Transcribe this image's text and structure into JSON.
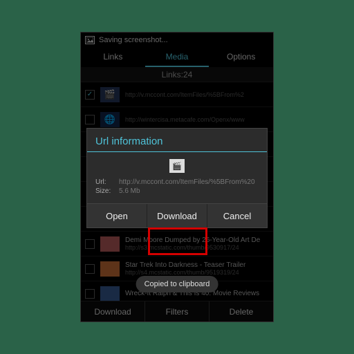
{
  "status": {
    "text": "Saving screenshot..."
  },
  "tabs": {
    "links": "Links",
    "media": "Media",
    "options": "Options"
  },
  "links_header": "Links:24",
  "rows": [
    {
      "checked": true,
      "title": "",
      "url": "http://v.mccont.com/ItemFiles/%5BFrom%2"
    },
    {
      "checked": false,
      "title": "",
      "url": "http://wintercisa.metacafe.com/Openx/www"
    },
    {
      "checked": false,
      "title": "",
      "url": ""
    },
    {
      "checked": false,
      "title": "",
      "url": ""
    },
    {
      "checked": false,
      "title": "",
      "url": ""
    },
    {
      "checked": false,
      "title": "Demi Moore Dumped by 26-Year-Old Art De",
      "url": "http://s3.mcstatic.com/thumb/9530917/24"
    },
    {
      "checked": false,
      "title": "Star Trek Into Darkness - Teaser Trailer",
      "url": "http://s4.mcstatic.com/thumb/9519319/24"
    },
    {
      "checked": false,
      "title": "Wreck-It Ralph & This Is 40: Movie Reviews",
      "url": ""
    }
  ],
  "bottom": {
    "download": "Download",
    "filters": "Filters",
    "delete": "Delete"
  },
  "dialog": {
    "title": "Url information",
    "url_label": "Url:",
    "url_value": "http://v.mccont.com/ItemFiles/%5BFrom%20",
    "size_label": "Size:",
    "size_value": "5.6 Mb",
    "open": "Open",
    "download": "Download",
    "cancel": "Cancel"
  },
  "toast": "Copied to clipboard"
}
